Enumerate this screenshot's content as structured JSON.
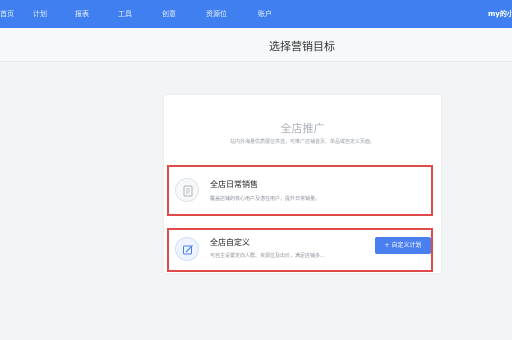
{
  "nav": {
    "items": [
      "首页",
      "计划",
      "报表",
      "工具",
      "创意",
      "资源位",
      "账户"
    ],
    "user": "my的小"
  },
  "page": {
    "title": "选择营销目标"
  },
  "card": {
    "title": "全店推广",
    "description": "站内外海量优质展位供选，可推广店铺首页、单品或自定义页面。"
  },
  "options": {
    "daily": {
      "icon": "document-icon",
      "title": "全店日常销售",
      "description": "覆盖店铺的核心用户及潜在用户，提升日常销量。"
    },
    "custom": {
      "icon": "edit-icon",
      "title": "全店自定义",
      "description": "可自主设置定向人群、资源位及出价，满足店铺多...",
      "button": "+ 自定义计划"
    }
  },
  "colors": {
    "nav_bg": "#3f7ff0",
    "highlight_border": "#e04a4a",
    "button_bg": "#4a7ff0"
  }
}
